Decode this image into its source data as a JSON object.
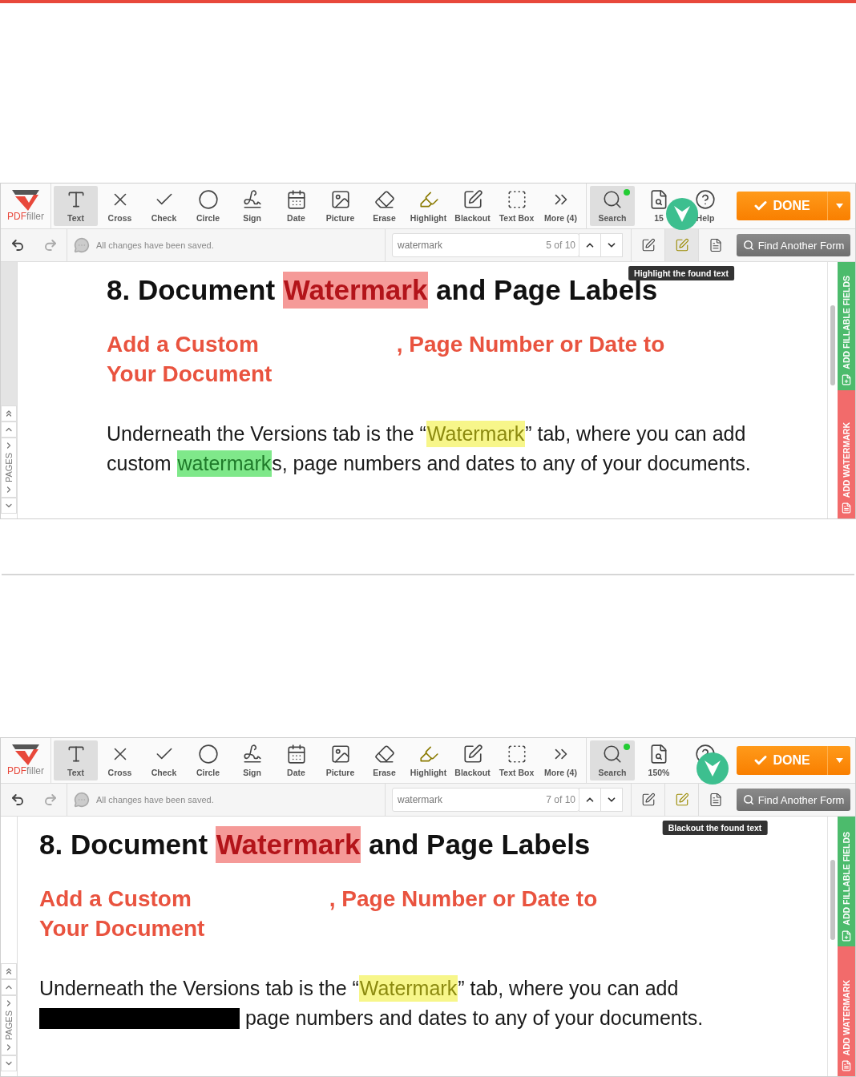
{
  "screenshots": [
    {
      "logo": {
        "brand": "PDF",
        "suffix": "filler"
      },
      "tools": [
        {
          "kind": "text",
          "label": "Text",
          "selected": true
        },
        {
          "kind": "cross",
          "label": "Cross",
          "selected": false
        },
        {
          "kind": "check",
          "label": "Check",
          "selected": false
        },
        {
          "kind": "circle",
          "label": "Circle",
          "selected": false
        },
        {
          "kind": "sign",
          "label": "Sign",
          "selected": false
        },
        {
          "kind": "date",
          "label": "Date",
          "selected": false
        },
        {
          "kind": "picture",
          "label": "Picture",
          "selected": false
        },
        {
          "kind": "erase",
          "label": "Erase",
          "selected": false
        },
        {
          "kind": "highlight",
          "label": "Highlight",
          "selected": false
        },
        {
          "kind": "blackout",
          "label": "Blackout",
          "selected": false
        },
        {
          "kind": "textbox",
          "label": "Text Box",
          "selected": false
        },
        {
          "kind": "more",
          "label": "More (4)",
          "selected": false
        }
      ],
      "view_tools": [
        {
          "kind": "search",
          "label": "Search",
          "selected": true,
          "notice": true,
          "pointer": false
        },
        {
          "kind": "zoom",
          "label": "15",
          "selected": false,
          "notice": false,
          "pointer": true
        },
        {
          "kind": "help",
          "label": "Help",
          "selected": false,
          "notice": false,
          "pointer": false
        }
      ],
      "done": {
        "label": "DONE"
      },
      "status": "All changes have been saved.",
      "search": {
        "value": "watermark",
        "count": "5 of 10"
      },
      "search_actions": [
        {
          "kind": "erase",
          "selected": false
        },
        {
          "kind": "highlight",
          "selected": true,
          "tooltip": "Highlight the found text"
        },
        {
          "kind": "blackout",
          "selected": false
        }
      ],
      "find_button": "Find Another Form",
      "pages_label": "PAGES",
      "side_tabs": [
        {
          "label": "ADD FILLABLE FIELDS",
          "color": "#4cbb6c"
        },
        {
          "label": "ADD WATERMARK",
          "color": "#f26b6b"
        }
      ],
      "document": {
        "heading": [
          {
            "text": "8. Document ",
            "kind": "plain"
          },
          {
            "text": "Watermark",
            "kind": "red"
          },
          {
            "text": " and Page Labels",
            "kind": "plain"
          }
        ],
        "subheading": [
          [
            {
              "text": "Add a Custom",
              "kind": "plain"
            },
            {
              "kind": "gap"
            },
            {
              "text": ", Page Number or Date to",
              "kind": "plain"
            }
          ],
          [
            {
              "text": "Your Document",
              "kind": "plain"
            }
          ]
        ],
        "paragraph": [
          [
            {
              "text": "Underneath the Versions tab is the “",
              "kind": "plain"
            },
            {
              "text": "Watermark",
              "kind": "yellow"
            },
            {
              "text": "” tab, where you can add",
              "kind": "plain"
            }
          ],
          [
            {
              "text": "custom ",
              "kind": "plain"
            },
            {
              "text": "watermark",
              "kind": "green"
            },
            {
              "text": "s, page numbers and dates to any of your documents.",
              "kind": "plain"
            }
          ]
        ]
      }
    },
    {
      "logo": {
        "brand": "PDF",
        "suffix": "filler"
      },
      "tools": [
        {
          "kind": "text",
          "label": "Text",
          "selected": true
        },
        {
          "kind": "cross",
          "label": "Cross",
          "selected": false
        },
        {
          "kind": "check",
          "label": "Check",
          "selected": false
        },
        {
          "kind": "circle",
          "label": "Circle",
          "selected": false
        },
        {
          "kind": "sign",
          "label": "Sign",
          "selected": false
        },
        {
          "kind": "date",
          "label": "Date",
          "selected": false
        },
        {
          "kind": "picture",
          "label": "Picture",
          "selected": false
        },
        {
          "kind": "erase",
          "label": "Erase",
          "selected": false
        },
        {
          "kind": "highlight",
          "label": "Highlight",
          "selected": false
        },
        {
          "kind": "blackout",
          "label": "Blackout",
          "selected": false
        },
        {
          "kind": "textbox",
          "label": "Text Box",
          "selected": false
        },
        {
          "kind": "more",
          "label": "More (4)",
          "selected": false
        }
      ],
      "view_tools": [
        {
          "kind": "search",
          "label": "Search",
          "selected": true,
          "notice": true,
          "pointer": false
        },
        {
          "kind": "zoom",
          "label": "150%",
          "selected": false,
          "notice": false,
          "pointer": false
        },
        {
          "kind": "help",
          "selected": false,
          "notice": false,
          "pointer": true
        }
      ],
      "done": {
        "label": "DONE"
      },
      "status": "All changes have been saved.",
      "search": {
        "value": "watermark",
        "count": "7 of 10"
      },
      "search_actions": [
        {
          "kind": "erase",
          "selected": false
        },
        {
          "kind": "highlight",
          "selected": false
        },
        {
          "kind": "blackout",
          "selected": false,
          "tooltip": "Blackout the found text"
        }
      ],
      "find_button": "Find Another Form",
      "pages_label": "PAGES",
      "side_tabs": [
        {
          "label": "ADD FILLABLE FIELDS",
          "color": "#4cbb6c"
        },
        {
          "label": "ADD WATERMARK",
          "color": "#f26b6b"
        }
      ],
      "document": {
        "heading": [
          {
            "text": "8. Document ",
            "kind": "plain"
          },
          {
            "text": "Watermark",
            "kind": "red"
          },
          {
            "text": " and Page Labels",
            "kind": "plain"
          }
        ],
        "subheading": [
          [
            {
              "text": "Add a Custom",
              "kind": "plain"
            },
            {
              "kind": "gap"
            },
            {
              "text": ", Page Number or Date to",
              "kind": "plain"
            }
          ],
          [
            {
              "text": "Your Document",
              "kind": "plain"
            }
          ]
        ],
        "paragraph": [
          [
            {
              "text": "Underneath the Versions tab is the “",
              "kind": "plain"
            },
            {
              "text": "Watermark",
              "kind": "yellow"
            },
            {
              "text": "” tab, where you can add",
              "kind": "plain"
            }
          ],
          [
            {
              "kind": "blackout"
            },
            {
              "text": " page numbers and dates to any of your documents.",
              "kind": "plain"
            }
          ]
        ]
      }
    }
  ]
}
